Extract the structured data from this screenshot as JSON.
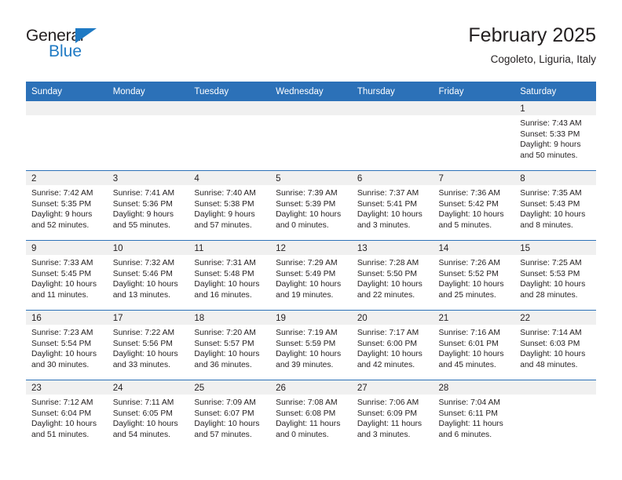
{
  "brand": {
    "name_top": "General",
    "name_bottom": "Blue",
    "accent_color": "#1f7ac4"
  },
  "header": {
    "month_title": "February 2025",
    "location": "Cogoleto, Liguria, Italy"
  },
  "colors": {
    "header_blue": "#2c71b8",
    "daynum_band": "#f0f0f0",
    "text": "#231f20"
  },
  "day_headers": [
    "Sunday",
    "Monday",
    "Tuesday",
    "Wednesday",
    "Thursday",
    "Friday",
    "Saturday"
  ],
  "weeks": [
    [
      {
        "blank": true
      },
      {
        "blank": true
      },
      {
        "blank": true
      },
      {
        "blank": true
      },
      {
        "blank": true
      },
      {
        "blank": true
      },
      {
        "day": "1",
        "sunrise": "Sunrise: 7:43 AM",
        "sunset": "Sunset: 5:33 PM",
        "daylight1": "Daylight: 9 hours",
        "daylight2": "and 50 minutes."
      }
    ],
    [
      {
        "day": "2",
        "sunrise": "Sunrise: 7:42 AM",
        "sunset": "Sunset: 5:35 PM",
        "daylight1": "Daylight: 9 hours",
        "daylight2": "and 52 minutes."
      },
      {
        "day": "3",
        "sunrise": "Sunrise: 7:41 AM",
        "sunset": "Sunset: 5:36 PM",
        "daylight1": "Daylight: 9 hours",
        "daylight2": "and 55 minutes."
      },
      {
        "day": "4",
        "sunrise": "Sunrise: 7:40 AM",
        "sunset": "Sunset: 5:38 PM",
        "daylight1": "Daylight: 9 hours",
        "daylight2": "and 57 minutes."
      },
      {
        "day": "5",
        "sunrise": "Sunrise: 7:39 AM",
        "sunset": "Sunset: 5:39 PM",
        "daylight1": "Daylight: 10 hours",
        "daylight2": "and 0 minutes."
      },
      {
        "day": "6",
        "sunrise": "Sunrise: 7:37 AM",
        "sunset": "Sunset: 5:41 PM",
        "daylight1": "Daylight: 10 hours",
        "daylight2": "and 3 minutes."
      },
      {
        "day": "7",
        "sunrise": "Sunrise: 7:36 AM",
        "sunset": "Sunset: 5:42 PM",
        "daylight1": "Daylight: 10 hours",
        "daylight2": "and 5 minutes."
      },
      {
        "day": "8",
        "sunrise": "Sunrise: 7:35 AM",
        "sunset": "Sunset: 5:43 PM",
        "daylight1": "Daylight: 10 hours",
        "daylight2": "and 8 minutes."
      }
    ],
    [
      {
        "day": "9",
        "sunrise": "Sunrise: 7:33 AM",
        "sunset": "Sunset: 5:45 PM",
        "daylight1": "Daylight: 10 hours",
        "daylight2": "and 11 minutes."
      },
      {
        "day": "10",
        "sunrise": "Sunrise: 7:32 AM",
        "sunset": "Sunset: 5:46 PM",
        "daylight1": "Daylight: 10 hours",
        "daylight2": "and 13 minutes."
      },
      {
        "day": "11",
        "sunrise": "Sunrise: 7:31 AM",
        "sunset": "Sunset: 5:48 PM",
        "daylight1": "Daylight: 10 hours",
        "daylight2": "and 16 minutes."
      },
      {
        "day": "12",
        "sunrise": "Sunrise: 7:29 AM",
        "sunset": "Sunset: 5:49 PM",
        "daylight1": "Daylight: 10 hours",
        "daylight2": "and 19 minutes."
      },
      {
        "day": "13",
        "sunrise": "Sunrise: 7:28 AM",
        "sunset": "Sunset: 5:50 PM",
        "daylight1": "Daylight: 10 hours",
        "daylight2": "and 22 minutes."
      },
      {
        "day": "14",
        "sunrise": "Sunrise: 7:26 AM",
        "sunset": "Sunset: 5:52 PM",
        "daylight1": "Daylight: 10 hours",
        "daylight2": "and 25 minutes."
      },
      {
        "day": "15",
        "sunrise": "Sunrise: 7:25 AM",
        "sunset": "Sunset: 5:53 PM",
        "daylight1": "Daylight: 10 hours",
        "daylight2": "and 28 minutes."
      }
    ],
    [
      {
        "day": "16",
        "sunrise": "Sunrise: 7:23 AM",
        "sunset": "Sunset: 5:54 PM",
        "daylight1": "Daylight: 10 hours",
        "daylight2": "and 30 minutes."
      },
      {
        "day": "17",
        "sunrise": "Sunrise: 7:22 AM",
        "sunset": "Sunset: 5:56 PM",
        "daylight1": "Daylight: 10 hours",
        "daylight2": "and 33 minutes."
      },
      {
        "day": "18",
        "sunrise": "Sunrise: 7:20 AM",
        "sunset": "Sunset: 5:57 PM",
        "daylight1": "Daylight: 10 hours",
        "daylight2": "and 36 minutes."
      },
      {
        "day": "19",
        "sunrise": "Sunrise: 7:19 AM",
        "sunset": "Sunset: 5:59 PM",
        "daylight1": "Daylight: 10 hours",
        "daylight2": "and 39 minutes."
      },
      {
        "day": "20",
        "sunrise": "Sunrise: 7:17 AM",
        "sunset": "Sunset: 6:00 PM",
        "daylight1": "Daylight: 10 hours",
        "daylight2": "and 42 minutes."
      },
      {
        "day": "21",
        "sunrise": "Sunrise: 7:16 AM",
        "sunset": "Sunset: 6:01 PM",
        "daylight1": "Daylight: 10 hours",
        "daylight2": "and 45 minutes."
      },
      {
        "day": "22",
        "sunrise": "Sunrise: 7:14 AM",
        "sunset": "Sunset: 6:03 PM",
        "daylight1": "Daylight: 10 hours",
        "daylight2": "and 48 minutes."
      }
    ],
    [
      {
        "day": "23",
        "sunrise": "Sunrise: 7:12 AM",
        "sunset": "Sunset: 6:04 PM",
        "daylight1": "Daylight: 10 hours",
        "daylight2": "and 51 minutes."
      },
      {
        "day": "24",
        "sunrise": "Sunrise: 7:11 AM",
        "sunset": "Sunset: 6:05 PM",
        "daylight1": "Daylight: 10 hours",
        "daylight2": "and 54 minutes."
      },
      {
        "day": "25",
        "sunrise": "Sunrise: 7:09 AM",
        "sunset": "Sunset: 6:07 PM",
        "daylight1": "Daylight: 10 hours",
        "daylight2": "and 57 minutes."
      },
      {
        "day": "26",
        "sunrise": "Sunrise: 7:08 AM",
        "sunset": "Sunset: 6:08 PM",
        "daylight1": "Daylight: 11 hours",
        "daylight2": "and 0 minutes."
      },
      {
        "day": "27",
        "sunrise": "Sunrise: 7:06 AM",
        "sunset": "Sunset: 6:09 PM",
        "daylight1": "Daylight: 11 hours",
        "daylight2": "and 3 minutes."
      },
      {
        "day": "28",
        "sunrise": "Sunrise: 7:04 AM",
        "sunset": "Sunset: 6:11 PM",
        "daylight1": "Daylight: 11 hours",
        "daylight2": "and 6 minutes."
      },
      {
        "blank": true
      }
    ]
  ]
}
